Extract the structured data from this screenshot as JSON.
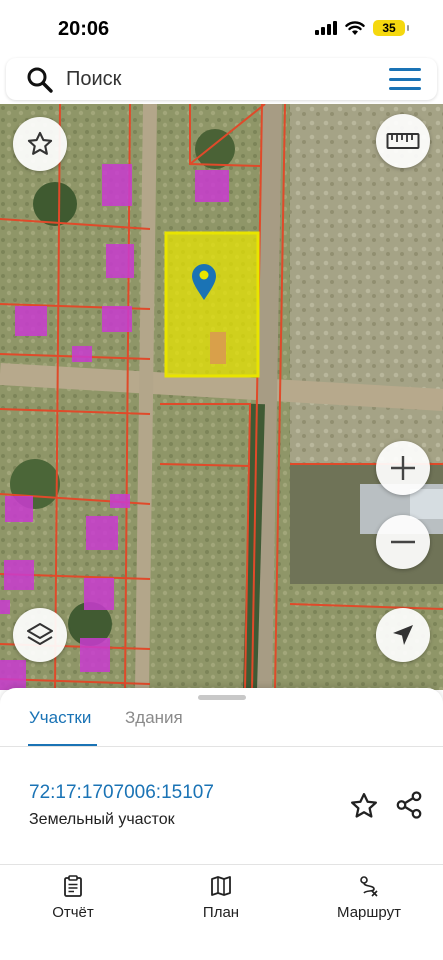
{
  "status": {
    "time": "20:06",
    "battery": "35"
  },
  "search": {
    "placeholder": "Поиск"
  },
  "tabs": [
    {
      "label": "Участки"
    },
    {
      "label": "Здания"
    }
  ],
  "parcel": {
    "number": "72:17:1707006:15107",
    "type": "Земельный участок"
  },
  "nav": [
    {
      "label": "Отчёт"
    },
    {
      "label": "План"
    },
    {
      "label": "Маршрут"
    }
  ],
  "colors": {
    "accent": "#1a73b5",
    "parcel_highlight": "#e9e600",
    "parcel_border": "#e04a2a",
    "building": "#c93bd0"
  }
}
